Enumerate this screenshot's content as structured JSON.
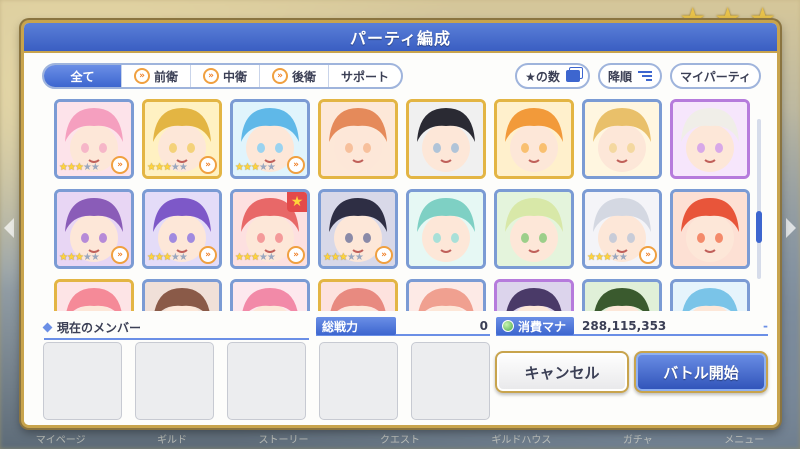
{
  "dialog": {
    "title": "パーティ編成"
  },
  "filters": {
    "tabs": [
      {
        "label": "全て",
        "active": true,
        "icon": ""
      },
      {
        "label": "前衛",
        "active": false,
        "icon": "position-icon"
      },
      {
        "label": "中衛",
        "active": false,
        "icon": "position-icon"
      },
      {
        "label": "後衛",
        "active": false,
        "icon": "position-icon"
      },
      {
        "label": "サポート",
        "active": false,
        "icon": ""
      }
    ],
    "sort_label": "★の数",
    "order_label": "降順",
    "my_party_label": "マイパーティ"
  },
  "characters": [
    {
      "frame": "blue",
      "colors": [
        "#f6b6c8",
        "#fde3ea"
      ],
      "stars": 3,
      "hair": "#f59fbf"
    },
    {
      "frame": "gold",
      "colors": [
        "#f4d27a",
        "#fff1c2"
      ],
      "stars": 3,
      "hair": "#e3b543"
    },
    {
      "frame": "blue",
      "colors": [
        "#9ad3f0",
        "#e0f4fc"
      ],
      "stars": 3,
      "hair": "#5fb8e8"
    },
    {
      "frame": "gold",
      "colors": [
        "#f7c09c",
        "#fde8d8"
      ],
      "stars": 0,
      "hair": "#e58a5a"
    },
    {
      "frame": "gold",
      "colors": [
        "#b0c4d8",
        "#f0f0f0"
      ],
      "stars": 0,
      "hair": "#2a2a33"
    },
    {
      "frame": "gold",
      "colors": [
        "#f9c070",
        "#fff0cc"
      ],
      "stars": 0,
      "hair": "#f29a3a"
    },
    {
      "frame": "blue",
      "colors": [
        "#f4d8a0",
        "#fff6e0"
      ],
      "stars": 0,
      "hair": "#e9c06a"
    },
    {
      "frame": "purple",
      "colors": [
        "#d8a8e8",
        "#f6e6fc"
      ],
      "stars": 0,
      "hair": "#f0eee8"
    },
    {
      "frame": "blue",
      "colors": [
        "#b68ad8",
        "#e8d6f4"
      ],
      "stars": 3,
      "hair": "#8a5cb8"
    },
    {
      "frame": "blue",
      "colors": [
        "#a08ae0",
        "#e4dcf8"
      ],
      "stars": 3,
      "hair": "#7d58c8"
    },
    {
      "frame": "blue",
      "colors": [
        "#f49a9a",
        "#fde0e0"
      ],
      "stars": 3,
      "hair": "#e86868",
      "badge": true
    },
    {
      "frame": "blue",
      "colors": [
        "#8a8aa8",
        "#d8d8e8"
      ],
      "stars": 3,
      "hair": "#2e2e44"
    },
    {
      "frame": "blue",
      "colors": [
        "#a8e0d8",
        "#e6f8f4"
      ],
      "stars": 0,
      "hair": "#7ed0c4"
    },
    {
      "frame": "blue",
      "colors": [
        "#9ccf8a",
        "#e4f4dc"
      ],
      "stars": 0,
      "hair": "#d8e8a8"
    },
    {
      "frame": "blue",
      "colors": [
        "#c8ccd8",
        "#f4f4f8"
      ],
      "stars": 3,
      "hair": "#d4d8e2"
    },
    {
      "frame": "blue",
      "colors": [
        "#f48a6a",
        "#fde0d4"
      ],
      "stars": 0,
      "hair": "#e8553a"
    },
    {
      "frame": "gold",
      "colors": [
        "#f8a8b0",
        "#fde4e6"
      ],
      "stars": 0,
      "hair": "#f58a98"
    },
    {
      "frame": "blue",
      "colors": [
        "#b88a78",
        "#f0e0d8"
      ],
      "stars": 0,
      "hair": "#8a5a48"
    },
    {
      "frame": "blue",
      "colors": [
        "#f8b8c8",
        "#fde8ee"
      ],
      "stars": 0,
      "hair": "#f28aa8"
    },
    {
      "frame": "gold",
      "colors": [
        "#f4a8a0",
        "#fde2de"
      ],
      "stars": 0,
      "hair": "#e88a80"
    },
    {
      "frame": "blue",
      "colors": [
        "#f8c0b8",
        "#fdeae6"
      ],
      "stars": 0,
      "hair": "#f0a090"
    },
    {
      "frame": "purple",
      "colors": [
        "#8a7aa8",
        "#dcd4ec"
      ],
      "stars": 0,
      "hair": "#4a3a68"
    },
    {
      "frame": "blue",
      "colors": [
        "#8ac078",
        "#e0f0d8"
      ],
      "stars": 0,
      "hair": "#3a5a2e"
    },
    {
      "frame": "blue",
      "colors": [
        "#a8d8f0",
        "#e6f4fc"
      ],
      "stars": 0,
      "hair": "#7ac4e8"
    }
  ],
  "members": {
    "title": "現在のメンバー",
    "slots": 5
  },
  "stats": {
    "power_label": "総戦力",
    "power_value": "0",
    "mana_label": "消費マナ",
    "mana_value": "288,115,353",
    "mana_suffix": "-"
  },
  "buttons": {
    "cancel": "キャンセル",
    "battle": "バトル開始"
  },
  "background": {
    "footer_items": [
      "マイページ",
      "ギルド",
      "ストーリー",
      "クエスト",
      "ギルドハウス",
      "ガチャ",
      "メニュー"
    ]
  },
  "colors": {
    "accent": "#3d66cf",
    "gold_frame": "#c8a44d",
    "star": "#ffd43b"
  }
}
